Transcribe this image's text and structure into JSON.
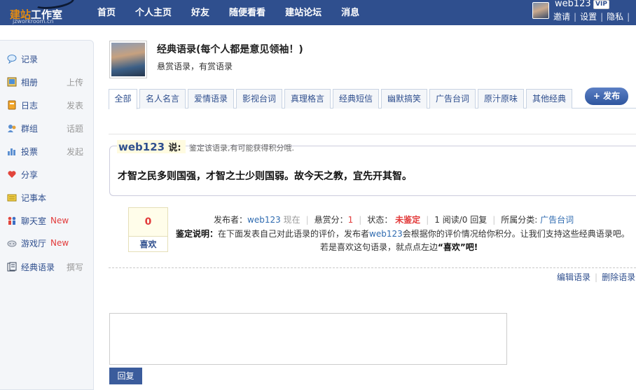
{
  "logo": {
    "text_orange": "建站",
    "text_white": "工作室",
    "sub": "jzworkroom.cn"
  },
  "nav": [
    "首页",
    "个人主页",
    "好友",
    "随便看看",
    "建站论坛",
    "消息"
  ],
  "user": {
    "name": "web123",
    "badge": "VIP",
    "links": [
      "邀请",
      "设置",
      "隐私"
    ]
  },
  "sidebar": [
    {
      "icon": "speech-bubble-icon",
      "label": "记录",
      "sub": ""
    },
    {
      "icon": "photo-album-icon",
      "label": "相册",
      "sub": "上传"
    },
    {
      "icon": "diary-icon",
      "label": "日志",
      "sub": "发表"
    },
    {
      "icon": "group-icon",
      "label": "群组",
      "sub": "话题"
    },
    {
      "icon": "poll-bars-icon",
      "label": "投票",
      "sub": "发起"
    },
    {
      "icon": "share-heart-icon",
      "label": "分享",
      "sub": ""
    },
    {
      "icon": "notebook-icon",
      "label": "记事本",
      "sub": ""
    },
    {
      "icon": "chat-people-icon",
      "label": "聊天室",
      "sub": "",
      "badge": "New"
    },
    {
      "icon": "gamepad-icon",
      "label": "游戏厅",
      "sub": "",
      "badge": "New"
    },
    {
      "icon": "quote-book-icon",
      "label": "经典语录",
      "sub": "撰写"
    }
  ],
  "header": {
    "title": "经典语录(每个人都是意见领袖！)",
    "subtitle": "悬赏语录，有赏语录"
  },
  "tabs": [
    "全部",
    "名人名言",
    "爱情语录",
    "影视台词",
    "真理格言",
    "经典短信",
    "幽默搞笑",
    "广告台词",
    "原汁原味",
    "其他经典"
  ],
  "publish_label": "+ 发布",
  "quote": {
    "author": "web123",
    "say": "说:",
    "note": "鉴定该语录,有可能获得积分哦.",
    "text": "才智之民多则国强，才智之士少则国弱。故今天之教，宜先开其智。"
  },
  "like": {
    "count": "0",
    "label": "喜欢"
  },
  "meta": {
    "poster_label": "发布者：",
    "poster": "web123",
    "time": "现在",
    "reward_label": "悬赏分：",
    "reward": "1",
    "status_label": "状态：",
    "status": "未鉴定",
    "reads": "1",
    "reads_label": "阅读/0 回复",
    "category_label": "所属分类:",
    "category": "广告台词"
  },
  "desc": {
    "label": "鉴定说明：",
    "text1": "在下面发表自己对此语录的评价，发布者",
    "poster": "web123",
    "text2": "会根据你的评价情况给你积分。让我们支持这些经典语录吧。",
    "line2_pre": "若是喜欢这句语录，就点点左边",
    "line2_em": "“喜欢”",
    "line2_post": "吧!"
  },
  "actions": [
    "编辑语录",
    "删除语录"
  ],
  "reply_label": "回复",
  "colors": {
    "topbar": "#2f4f8e",
    "link": "#2f4f8e",
    "alert": "#e23b3b"
  }
}
